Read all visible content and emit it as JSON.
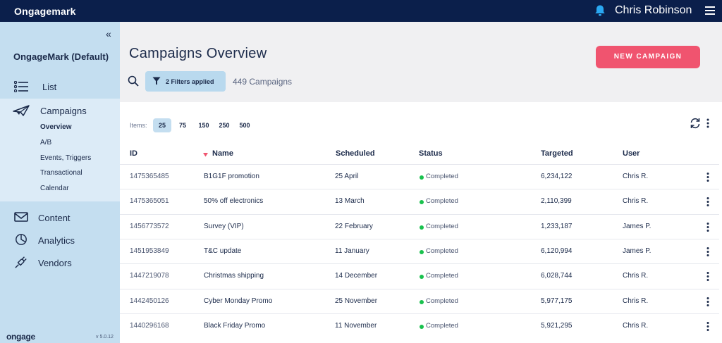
{
  "app": {
    "brand": "Ongagemark",
    "user_name": "Chris Robinson"
  },
  "sidebar": {
    "collapse_glyph": "«",
    "account_name": "OngageMark (Default)",
    "list_label": "List",
    "campaigns_label": "Campaigns",
    "campaign_subitems": [
      "Overview",
      "A/B",
      "Events, Triggers",
      "Transactional",
      "Calendar"
    ],
    "active_subitem": "Overview",
    "content_label": "Content",
    "analytics_label": "Analytics",
    "vendors_label": "Vendors",
    "logo_text": "ongage",
    "version": "v 5.0.12"
  },
  "page": {
    "title": "Campaigns Overview",
    "new_campaign_label": "NEW CAMPAIGN",
    "filters_label": "2 Filters applied",
    "campaign_count": "449 Campaigns"
  },
  "pagination": {
    "items_label": "Items:",
    "sizes": [
      "25",
      "75",
      "150",
      "250",
      "500"
    ],
    "active_size": "25"
  },
  "table": {
    "columns": {
      "id": "ID",
      "name": "Name",
      "scheduled": "Scheduled",
      "status": "Status",
      "targeted": "Targeted",
      "user": "User"
    },
    "sorted_column": "name",
    "rows": [
      {
        "id": "1475365485",
        "name": "B1G1F promotion",
        "scheduled": "25 April",
        "status": "Completed",
        "targeted": "6,234,122",
        "user": "Chris R."
      },
      {
        "id": "1475365051",
        "name": "50% off electronics",
        "scheduled": "13 March",
        "status": "Completed",
        "targeted": "2,110,399",
        "user": "Chris R."
      },
      {
        "id": "1456773572",
        "name": "Survey (VIP)",
        "scheduled": "22 February",
        "status": "Completed",
        "targeted": "1,233,187",
        "user": "James P."
      },
      {
        "id": "1451953849",
        "name": "T&C update",
        "scheduled": "11 January",
        "status": "Completed",
        "targeted": "6,120,994",
        "user": "James P."
      },
      {
        "id": "1447219078",
        "name": "Christmas shipping",
        "scheduled": "14 December",
        "status": "Completed",
        "targeted": "6,028,744",
        "user": "Chris R."
      },
      {
        "id": "1442450126",
        "name": "Cyber Monday Promo",
        "scheduled": "25 November",
        "status": "Completed",
        "targeted": "5,977,175",
        "user": "Chris R."
      },
      {
        "id": "1440296168",
        "name": "Black Friday Promo",
        "scheduled": "11 November",
        "status": "Completed",
        "targeted": "5,921,295",
        "user": "Chris R."
      }
    ]
  },
  "colors": {
    "topbar": "#0b1f4b",
    "sidebar": "#c4def0",
    "accent_button": "#f0546f",
    "status_completed": "#19c14d",
    "bell": "#2aa8f2"
  },
  "icons": [
    "bell-icon",
    "hamburger-icon",
    "list-icon",
    "paper-plane-icon",
    "envelope-icon",
    "pie-chart-icon",
    "plug-icon",
    "search-icon",
    "filter-icon",
    "refresh-icon",
    "kebab-icon",
    "sort-desc-icon"
  ]
}
